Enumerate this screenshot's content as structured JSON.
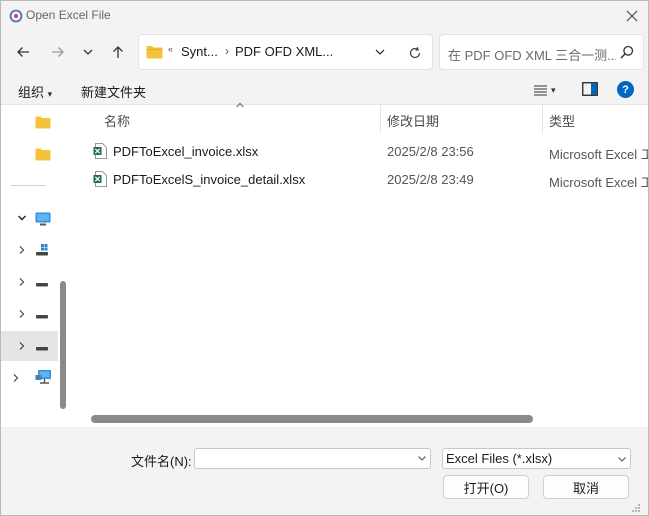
{
  "window": {
    "title": "Open Excel File"
  },
  "nav": {
    "back_icon": "arrow-left-icon",
    "forward_icon": "arrow-right-icon",
    "recent_icon": "chevron-down-icon",
    "up_icon": "arrow-up-icon"
  },
  "address": {
    "overflow": "«",
    "crumbs": [
      "Synt...",
      "PDF OFD XML..."
    ],
    "separator": "›"
  },
  "search": {
    "placeholder": "在 PDF OFD XML 三合一测..."
  },
  "toolbar": {
    "organize": "组织",
    "organize_arrow": "▾",
    "new_folder": "新建文件夹",
    "view_arrow": "▾",
    "help": "?"
  },
  "columns": {
    "name": "名称",
    "date": "修改日期",
    "type": "类型"
  },
  "files": [
    {
      "name": "PDFToExcel_invoice.xlsx",
      "date": "2025/2/8 23:56",
      "type": "Microsoft Excel 工"
    },
    {
      "name": "PDFToExcelS_invoice_detail.xlsx",
      "date": "2025/2/8 23:49",
      "type": "Microsoft Excel 工"
    }
  ],
  "footer": {
    "filename_label": "文件名(N):",
    "filename_value": "",
    "filter_value": "Excel Files (*.xlsx)",
    "open_button": "打开(O)",
    "cancel_button": "取消"
  },
  "colors": {
    "accent": "#0067c0",
    "folder": "#f5c33b",
    "excel": "#1d7044",
    "scroll_thumb": "#8a8a8a"
  }
}
